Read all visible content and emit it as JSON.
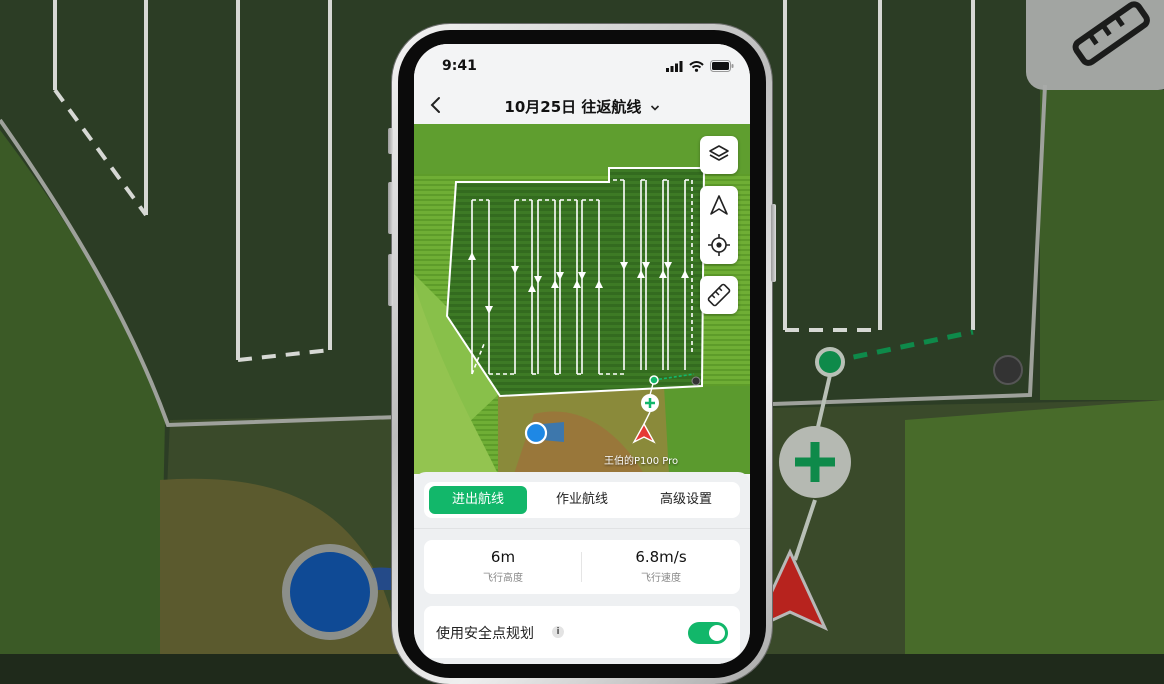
{
  "status_bar": {
    "time": "9:41"
  },
  "nav": {
    "title": "10月25日 往返航线"
  },
  "map": {
    "drone_label": "王伯的P100 Pro"
  },
  "tabs": [
    {
      "label": "进出航线",
      "active": true
    },
    {
      "label": "作业航线",
      "active": false
    },
    {
      "label": "高级设置",
      "active": false
    }
  ],
  "stats": [
    {
      "value": "6m",
      "label": "飞行高度"
    },
    {
      "value": "6.8m/s",
      "label": "飞行速度"
    }
  ],
  "safety": {
    "label": "使用安全点规划",
    "info": "i",
    "enabled": true
  },
  "colors": {
    "accent": "#12b76a",
    "route": "#ffffff",
    "drone": "#e53935",
    "home": "#1e88e5"
  },
  "icons": [
    "back-icon",
    "chevron-down-icon",
    "layers-icon",
    "navigation-arrow-icon",
    "locate-icon",
    "ruler-icon",
    "add-waypoint-icon",
    "drone-arrow-icon"
  ]
}
